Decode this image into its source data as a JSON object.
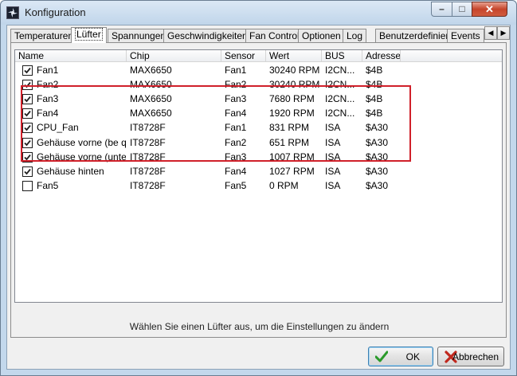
{
  "window": {
    "title": "Konfiguration",
    "icon": "fan-app-icon",
    "caption_buttons": {
      "minimize": "–",
      "maximize": "□",
      "close": "✕"
    }
  },
  "tabs": [
    {
      "label": "Temperaturen"
    },
    {
      "label": "Lüfter",
      "active": true
    },
    {
      "label": "Spannungen"
    },
    {
      "label": "Geschwindigkeiten"
    },
    {
      "label": "Fan Control"
    },
    {
      "label": "Optionen"
    },
    {
      "label": "Log"
    },
    {
      "label": "Benutzerdefiniert"
    },
    {
      "label": "Events"
    }
  ],
  "tab_scroll": {
    "left": "◀",
    "right": "▶"
  },
  "list": {
    "columns": [
      "Name",
      "Chip",
      "Sensor",
      "Wert",
      "BUS",
      "Adresse"
    ],
    "rows": [
      {
        "checked": true,
        "name": "Fan1",
        "chip": "MAX6650",
        "sensor": "Fan1",
        "wert": "30240 RPM",
        "bus": "I2CN...",
        "adresse": "$4B"
      },
      {
        "checked": true,
        "name": "Fan2",
        "chip": "MAX6650",
        "sensor": "Fan2",
        "wert": "30240 RPM",
        "bus": "I2CN...",
        "adresse": "$4B"
      },
      {
        "checked": true,
        "name": "Fan3",
        "chip": "MAX6650",
        "sensor": "Fan3",
        "wert": "7680 RPM",
        "bus": "I2CN...",
        "adresse": "$4B"
      },
      {
        "checked": true,
        "name": "Fan4",
        "chip": "MAX6650",
        "sensor": "Fan4",
        "wert": "1920 RPM",
        "bus": "I2CN...",
        "adresse": "$4B"
      },
      {
        "checked": true,
        "name": "CPU_Fan",
        "chip": "IT8728F",
        "sensor": "Fan1",
        "wert": "831 RPM",
        "bus": "ISA",
        "adresse": "$A30"
      },
      {
        "checked": true,
        "name": "Gehäuse vorne (be q...",
        "chip": "IT8728F",
        "sensor": "Fan2",
        "wert": "651 RPM",
        "bus": "ISA",
        "adresse": "$A30"
      },
      {
        "checked": true,
        "name": "Gehäuse vorne (unten)",
        "chip": "IT8728F",
        "sensor": "Fan3",
        "wert": "1007 RPM",
        "bus": "ISA",
        "adresse": "$A30"
      },
      {
        "checked": true,
        "name": "Gehäuse hinten",
        "chip": "IT8728F",
        "sensor": "Fan4",
        "wert": "1027 RPM",
        "bus": "ISA",
        "adresse": "$A30"
      },
      {
        "checked": false,
        "name": "Fan5",
        "chip": "IT8728F",
        "sensor": "Fan5",
        "wert": "0 RPM",
        "bus": "ISA",
        "adresse": "$A30"
      }
    ]
  },
  "hint_text": "Wählen Sie einen Lüfter aus, um die Einstellungen zu ändern",
  "buttons": {
    "ok": {
      "label": "OK",
      "icon": "checkmark-icon"
    },
    "cancel": {
      "label": "Abbrechen",
      "icon": "x-icon"
    }
  },
  "colors": {
    "highlight": "#d0202a",
    "ok_icon": "#2a9a2a",
    "cancel_icon": "#c0281e"
  }
}
